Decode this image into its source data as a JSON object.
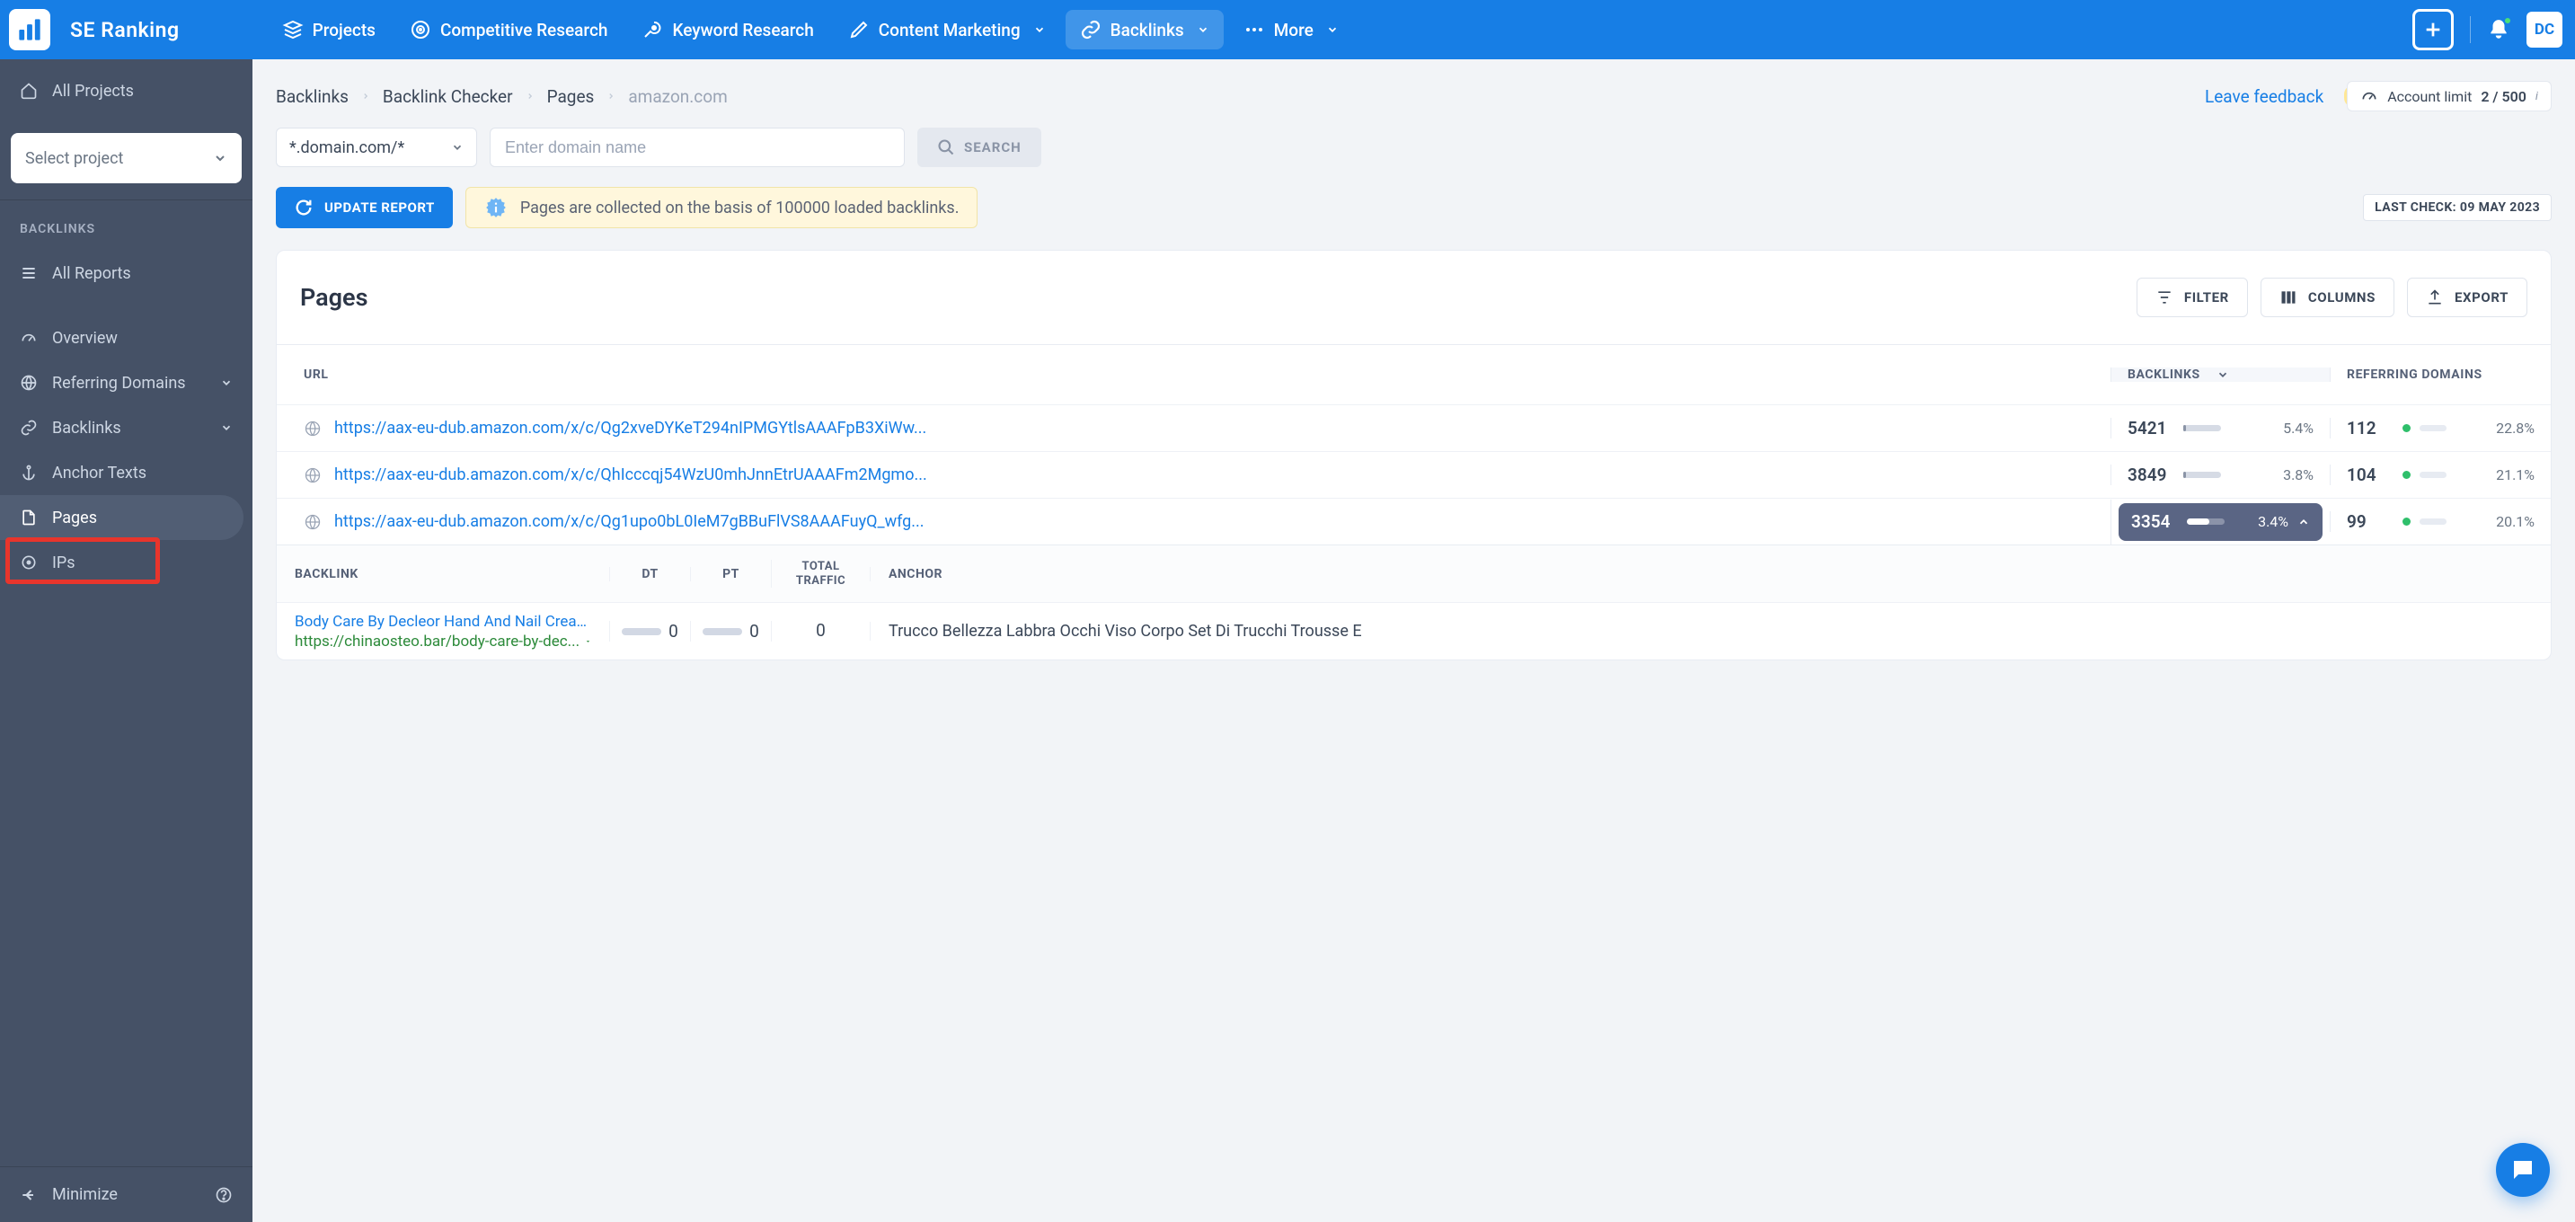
{
  "brand": "SE Ranking",
  "topnav": {
    "items": [
      {
        "label": "Projects"
      },
      {
        "label": "Competitive Research"
      },
      {
        "label": "Keyword Research"
      },
      {
        "label": "Content Marketing",
        "chev": true
      },
      {
        "label": "Backlinks",
        "chev": true,
        "active": true
      },
      {
        "label": "More",
        "chev": true,
        "dots": true
      }
    ],
    "avatar": "DC"
  },
  "sidebar": {
    "all_projects": "All Projects",
    "select_project": "Select project",
    "heading": "BACKLINKS",
    "all_reports": "All Reports",
    "items": [
      {
        "label": "Overview"
      },
      {
        "label": "Referring Domains",
        "chev": true
      },
      {
        "label": "Backlinks",
        "chev": true
      },
      {
        "label": "Anchor Texts"
      },
      {
        "label": "Pages",
        "active": true
      },
      {
        "label": "IPs"
      }
    ],
    "minimize": "Minimize"
  },
  "breadcrumbs": [
    "Backlinks",
    "Backlink Checker",
    "Pages",
    "amazon.com"
  ],
  "feedback": "Leave feedback",
  "account_limit": {
    "label": "Account limit",
    "value": "2 / 500"
  },
  "search": {
    "scope": "*.domain.com/*",
    "placeholder": "Enter domain name",
    "button": "SEARCH"
  },
  "update_btn": "UPDATE REPORT",
  "banner": "Pages are collected on the basis of 100000 loaded backlinks.",
  "last_check": "LAST CHECK: 09 MAY 2023",
  "card": {
    "title": "Pages",
    "actions": {
      "filter": "FILTER",
      "columns": "COLUMNS",
      "export": "EXPORT"
    },
    "columns": {
      "url": "URL",
      "backlinks": "BACKLINKS",
      "ref": "REFERRING DOMAINS"
    },
    "rows": [
      {
        "url": "https://aax-eu-dub.amazon.com/x/c/Qg2xveDYKeT294nIPMGYtlsAAAFpB3XiWw...",
        "bl_n": "5421",
        "bl_pct": "5.4%",
        "bl_w": 8,
        "rd_n": "112",
        "rd_pct": "22.8%"
      },
      {
        "url": "https://aax-eu-dub.amazon.com/x/c/QhIcccqj54WzU0mhJnnEtrUAAAFm2Mgmo...",
        "bl_n": "3849",
        "bl_pct": "3.8%",
        "bl_w": 6,
        "rd_n": "104",
        "rd_pct": "21.1%"
      },
      {
        "url": "https://aax-eu-dub.amazon.com/x/c/Qg1upo0bL0IeM7gBBuFlVS8AAAFuyQ_wfg...",
        "bl_n": "3354",
        "bl_pct": "3.4%",
        "bl_w": 60,
        "rd_n": "99",
        "rd_pct": "20.1%",
        "expanded": true
      }
    ],
    "sub_columns": {
      "backlink": "BACKLINK",
      "dt": "DT",
      "pt": "PT",
      "total_traffic": "TOTAL TRAFFIC",
      "anchor": "ANCHOR"
    },
    "sub_rows": [
      {
        "title": "Body Care By Decleor Hand And Nail Cream ...",
        "url": "https://chinaosteo.bar/body-care-by-dec...",
        "dt": "0",
        "pt": "0",
        "tt": "0",
        "anchor": "Trucco Bellezza Labbra Occhi Viso Corpo Set Di Trucchi Trousse E"
      }
    ]
  }
}
